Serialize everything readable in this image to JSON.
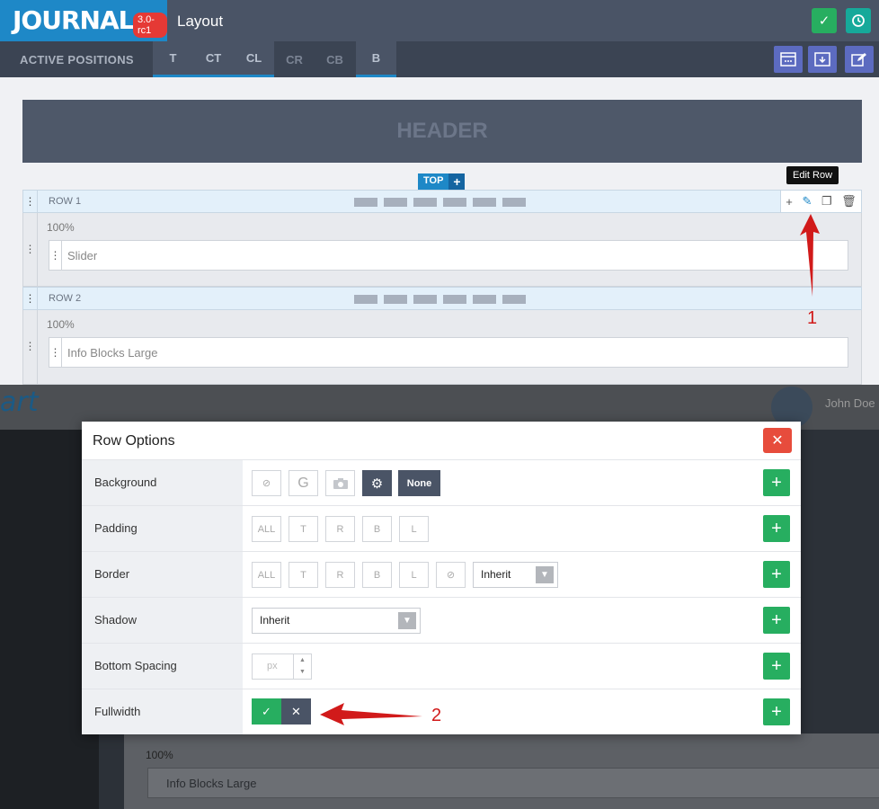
{
  "app": {
    "logo": "JOURNAL",
    "version": "3.0-rc1",
    "title": "Layout"
  },
  "positions": {
    "label": "ACTIVE POSITIONS",
    "tabs": [
      {
        "label": "T",
        "active": true
      },
      {
        "label": "CT",
        "active": true
      },
      {
        "label": "CL",
        "active": true
      },
      {
        "label": "CR",
        "active": false
      },
      {
        "label": "CB",
        "active": false
      },
      {
        "label": "B",
        "active": true
      }
    ]
  },
  "layout": {
    "header": "HEADER",
    "top_badge": "TOP",
    "rows": [
      {
        "title": "ROW 1",
        "width": "100%",
        "module": "Slider"
      },
      {
        "title": "ROW 2",
        "width": "100%",
        "module": "Info Blocks Large"
      }
    ],
    "tooltip": "Edit Row"
  },
  "background": {
    "user": "John Doe",
    "logo": "art",
    "row_width": "100%",
    "row_module": "Info Blocks Large"
  },
  "modal": {
    "title": "Row Options",
    "options": {
      "background": {
        "label": "Background",
        "none_label": "None"
      },
      "padding": {
        "label": "Padding",
        "buttons": [
          "ALL",
          "T",
          "R",
          "B",
          "L"
        ]
      },
      "border": {
        "label": "Border",
        "buttons": [
          "ALL",
          "T",
          "R",
          "B",
          "L"
        ],
        "select": "Inherit"
      },
      "shadow": {
        "label": "Shadow",
        "select": "Inherit"
      },
      "bottom_spacing": {
        "label": "Bottom Spacing",
        "placeholder": "px"
      },
      "fullwidth": {
        "label": "Fullwidth"
      }
    }
  },
  "annotations": {
    "one": "1",
    "two": "2"
  },
  "colors": {
    "accent": "#1e88c7",
    "success": "#27ae60",
    "danger": "#e74c3c",
    "dark": "#4a5466",
    "annotation": "#d11a1a"
  }
}
